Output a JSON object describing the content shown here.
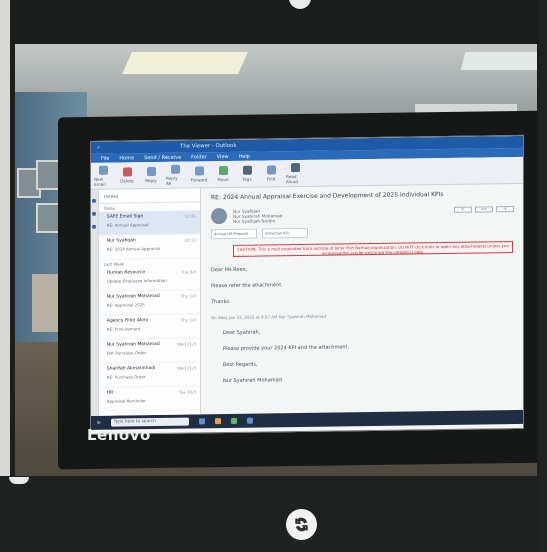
{
  "photo": {
    "monitor_brand": "Lenovo",
    "taskbar_search": "Type here to search"
  },
  "outlook": {
    "window_title": "The Viewer - Outlook",
    "tabs": [
      "File",
      "Home",
      "Send / Receive",
      "Folder",
      "View",
      "Help"
    ],
    "toolbar": [
      "New Email",
      "Delete",
      "Reply",
      "Reply All",
      "Forward",
      "Move",
      "Tags",
      "Find",
      "Read Aloud"
    ],
    "list": {
      "filter": "Unread",
      "groups": [
        "Today",
        "Last Week"
      ],
      "items": [
        {
          "from": "SAFE Email Sign",
          "subject": "RE: Annual Appraisal",
          "time": "12:41"
        },
        {
          "from": "Nur Syafiqah",
          "subject": "RE: 2024 Annual Appraisal",
          "time": "10:11"
        },
        {
          "from": "Human Resource",
          "subject": "Update Employee Information",
          "time": "Tue 8/4"
        },
        {
          "from": "Nur Syahirah Mohamad",
          "subject": "RE: Appraisal 2025",
          "time": "Thu 1/4"
        },
        {
          "from": "Agency Fillot Akmi",
          "subject": "RE: Procurement",
          "time": "Thu 1/4"
        },
        {
          "from": "Nur Syahirah Mohamad",
          "subject": "FW: Purchase Order",
          "time": "Wed 31/3"
        },
        {
          "from": "Sharifah Akmatinhadi",
          "subject": "RE: Purchase Order",
          "time": "Wed 31/3"
        },
        {
          "from": "HR",
          "subject": "Appraisal Reminder",
          "time": "Tue 30/3"
        }
      ]
    },
    "message": {
      "subject": "RE: 2024 Annual Appraisal Exercise and Development of 2025 Individual KPIs",
      "sender": "Nur Syafiqah",
      "meta": [
        "Nur Syahirah Mohamad",
        "Nur Syafiqah Nordin"
      ],
      "attachments": [
        "Annual HR Proposal",
        "Individual KPI"
      ],
      "warning": "CAUTION: This e-mail originated from outside of Johor Port Berhad organization. Do NOT click links or open any attachments unless you recognize the sender and know the content is safe.",
      "lines": [
        "Dear Ms Reen,",
        "Please refer the attachment.",
        "Thanks",
        "On Wed, Jan 15, 2025 at 9:57 AM Nur Syahirah Mohamad",
        "Dear Syahirah,",
        "Please provide your 2024 KPI and the attachment.",
        "Best Regards,",
        "Nur Syahirah Mohamad"
      ]
    }
  },
  "scanner_ui": {
    "rotate_button": "rotate-icon"
  }
}
